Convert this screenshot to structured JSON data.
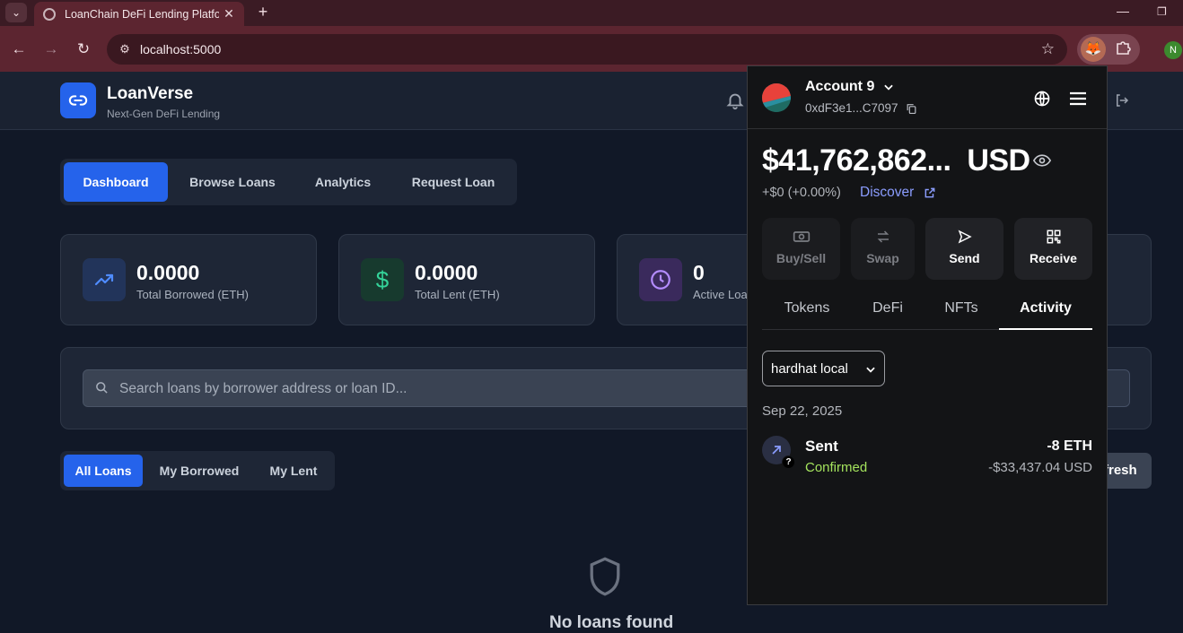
{
  "browser": {
    "tab_title": "LoanChain DeFi Lending Platform",
    "url": "localhost:5000",
    "profile_initial": "N"
  },
  "app": {
    "brand": "LoanVerse",
    "tagline": "Next-Gen DeFi Lending",
    "nav_tabs": [
      {
        "label": "Dashboard",
        "active": true
      },
      {
        "label": "Browse Loans",
        "active": false
      },
      {
        "label": "Analytics",
        "active": false
      },
      {
        "label": "Request Loan",
        "active": false
      }
    ],
    "stats": [
      {
        "value": "0.0000",
        "label": "Total Borrowed (ETH)",
        "icon": "trending-up-icon"
      },
      {
        "value": "0.0000",
        "label": "Total Lent (ETH)",
        "icon": "dollar-icon"
      },
      {
        "value": "0",
        "label": "Active Loa",
        "icon": "clock-icon"
      }
    ],
    "search": {
      "placeholder": "Search loans by borrower address or loan ID...",
      "filters_label": "rs"
    },
    "loan_tabs": [
      {
        "label": "All Loans",
        "active": true
      },
      {
        "label": "My Borrowed",
        "active": false
      },
      {
        "label": "My Lent",
        "active": false
      }
    ],
    "refresh_label": "fresh",
    "empty_text": "No loans found"
  },
  "wallet": {
    "account_name": "Account 9",
    "address": "0xdF3e1...C7097",
    "balance": "$41,762,862...",
    "currency": "USD",
    "change": "+$0 (+0.00%)",
    "discover": "Discover",
    "actions": [
      {
        "label": "Buy/Sell",
        "enabled": false
      },
      {
        "label": "Swap",
        "enabled": false
      },
      {
        "label": "Send",
        "enabled": true
      },
      {
        "label": "Receive",
        "enabled": true
      }
    ],
    "tabs": [
      {
        "label": "Tokens",
        "active": false
      },
      {
        "label": "DeFi",
        "active": false
      },
      {
        "label": "NFTs",
        "active": false
      },
      {
        "label": "Activity",
        "active": true
      }
    ],
    "network": "hardhat local",
    "activity": {
      "date": "Sep 22, 2025",
      "items": [
        {
          "type": "Sent",
          "status": "Confirmed",
          "amount": "-8 ETH",
          "usd": "-$33,437.04 USD"
        }
      ]
    }
  }
}
